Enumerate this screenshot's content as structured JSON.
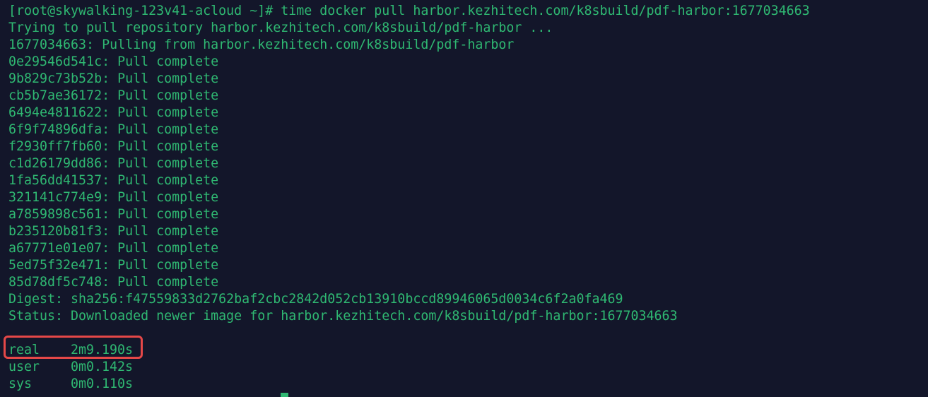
{
  "terminal": {
    "command_line": "[root@skywalking-123v41-acloud ~]# time docker pull harbor.kezhitech.com/k8sbuild/pdf-harbor:1677034663",
    "header_lines": [
      "Trying to pull repository harbor.kezhitech.com/k8sbuild/pdf-harbor ...",
      "1677034663: Pulling from harbor.kezhitech.com/k8sbuild/pdf-harbor"
    ],
    "layers": [
      "0e29546d541c: Pull complete",
      "9b829c73b52b: Pull complete",
      "cb5b7ae36172: Pull complete",
      "6494e4811622: Pull complete",
      "6f9f74896dfa: Pull complete",
      "f2930ff7fb60: Pull complete",
      "c1d26179dd86: Pull complete",
      "1fa56dd41537: Pull complete",
      "321141c774e9: Pull complete",
      "a7859898c561: Pull complete",
      "b235120b81f3: Pull complete",
      "a67771e01e07: Pull complete",
      "5ed75f32e471: Pull complete",
      "85d78df5c748: Pull complete"
    ],
    "digest_line": "Digest: sha256:f47559833d2762baf2cbc2842d052cb13910bccd89946065d0034c6f2a0fa469",
    "status_line": "Status: Downloaded newer image for harbor.kezhitech.com/k8sbuild/pdf-harbor:1677034663",
    "timing": {
      "real_label": "real",
      "real_value": "2m9.190s",
      "user_label": "user",
      "user_value": "0m0.142s",
      "sys_label": "sys",
      "sys_value": "0m0.110s"
    }
  },
  "colors": {
    "background": "#13162a",
    "text": "#2fb872",
    "highlight_border": "#e54848"
  }
}
